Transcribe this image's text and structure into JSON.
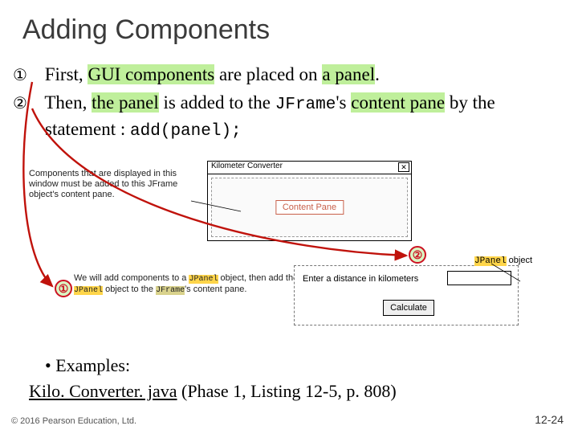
{
  "title": "Adding Components",
  "bullets": {
    "b1_marker": "①",
    "b1_text_pre": " First, ",
    "b1_hl": "GUI components",
    "b1_text_mid": " are placed on ",
    "b1_hl2": "a panel",
    "b1_text_post": ".",
    "b2_marker": "②",
    "b2_text_pre": " Then, ",
    "b2_hl": "the panel",
    "b2_text_mid": " is added to the ",
    "b2_code": "JFrame",
    "b2_text_mid2": "'s ",
    "b2_hl2": "content pane",
    "b2_text_mid3": " by the statement :   ",
    "b2_code2": "add(panel);"
  },
  "diagram": {
    "desc1": "Components that are displayed in this window must be added to this JFrame object's content pane.",
    "desc2_pre": "We will add components to a ",
    "desc2_c1": "JPanel",
    "desc2_mid1": " object, then add the ",
    "desc2_c2": "JPanel",
    "desc2_mid2": " object to the ",
    "desc2_c3": "JFrame",
    "desc2_post": "'s content pane.",
    "titlebar": "Kilometer Converter",
    "closeX": "✕",
    "contentPaneLabel": "Content Pane",
    "prompt": "Enter a distance in kilometers",
    "calcBtn": "Calculate",
    "jpanel_code": "JPanel",
    "jpanel_after": " object",
    "badge1": "①",
    "badge2": "②"
  },
  "examples": {
    "heading": "•  Examples:",
    "link_text": "Kilo. Converter. java",
    "ref": " (Phase 1, Listing 12-5, p. 808)"
  },
  "footer": {
    "copyright": "© 2016 Pearson Education, Ltd.",
    "pagenum": "12-24"
  }
}
